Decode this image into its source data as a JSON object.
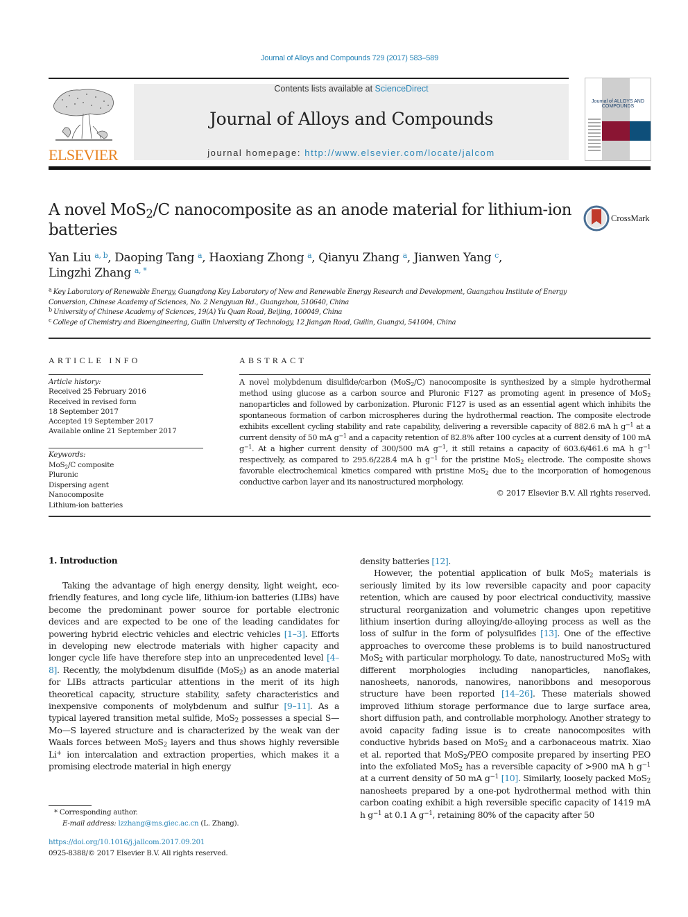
{
  "citation": "Journal of Alloys and Compounds 729 (2017) 583–589",
  "masthead": {
    "contents_prefix": "Contents lists available at ",
    "contents_link": "ScienceDirect",
    "journal_title": "Journal of Alloys and Compounds",
    "homepage_prefix": "journal homepage: ",
    "homepage_url": "http://www.elsevier.com/locate/jalcom",
    "publisher_logo": "ELSEVIER",
    "cover_text": "Journal of ALLOYS AND COMPOUNDS"
  },
  "colors": {
    "link": "#2a86b8",
    "elsevier_orange": "#e8821e",
    "masthead_bg": "#ededed",
    "cover_maroon": "#8a1533",
    "cover_blue": "#0e4f7a"
  },
  "article": {
    "title_part1": "A novel MoS",
    "title_sub": "2",
    "title_part2": "/C nanocomposite as an anode material for lithium-ion batteries",
    "crossmark_label": "CrossMark",
    "authors": [
      {
        "name": "Yan Liu",
        "aff": "a, b"
      },
      {
        "name": "Daoping Tang",
        "aff": "a"
      },
      {
        "name": "Haoxiang Zhong",
        "aff": "a"
      },
      {
        "name": "Qianyu Zhang",
        "aff": "a"
      },
      {
        "name": "Jianwen Yang",
        "aff": "c"
      },
      {
        "name": "Lingzhi Zhang",
        "aff": "a, *"
      }
    ],
    "affiliations": [
      {
        "key": "a",
        "text": "Key Laboratory of Renewable Energy, Guangdong Key Laboratory of New and Renewable Energy Research and Development, Guangzhou Institute of Energy Conversion, Chinese Academy of Sciences, No. 2 Nengyuan Rd., Guangzhou, 510640, China"
      },
      {
        "key": "b",
        "text": "University of Chinese Academy of Sciences, 19(A) Yu Quan Road, Beijing, 100049, China"
      },
      {
        "key": "c",
        "text": "College of Chemistry and Bioengineering, Guilin University of Technology, 12 Jiangan Road, Guilin, Guangxi, 541004, China"
      }
    ]
  },
  "article_info": {
    "heading": "ARTICLE INFO",
    "history_label": "Article history:",
    "history": [
      "Received 25 February 2016",
      "Received in revised form",
      "18 September 2017",
      "Accepted 19 September 2017",
      "Available online 21 September 2017"
    ],
    "keywords_label": "Keywords:",
    "keywords": [
      "MoS2/C composite",
      "Pluronic",
      "Dispersing agent",
      "Nanocomposite",
      "Lithium-ion batteries"
    ]
  },
  "abstract": {
    "heading": "ABSTRACT",
    "text": "A novel molybdenum disulfide/carbon (MoS₂/C) nanocomposite is synthesized by a simple hydrothermal method using glucose as a carbon source and Pluronic F127 as promoting agent in presence of MoS₂ nanoparticles and followed by carbonization. Pluronic F127 is used as an essential agent which inhibits the spontaneous formation of carbon microspheres during the hydrothermal reaction. The composite electrode exhibits excellent cycling stability and rate capability, delivering a reversible capacity of 882.6 mA h g⁻¹ at a current density of 50 mA g⁻¹ and a capacity retention of 82.8% after 100 cycles at a current density of 100 mA g⁻¹. At a higher current density of 300/500 mA g⁻¹, it still retains a capacity of 603.6/461.6 mA h g⁻¹ respectively, as compared to 295.6/228.4 mA h g⁻¹ for the pristine MoS₂ electrode. The composite shows favorable electrochemical kinetics compared with pristine MoS₂ due to the incorporation of homogenous conductive carbon layer and its nanostructured morphology.",
    "copyright": "© 2017 Elsevier B.V. All rights reserved."
  },
  "intro": {
    "heading": "1.  Introduction",
    "left_paragraph": "Taking the advantage of high energy density, light weight, eco-friendly features, and long cycle life, lithium-ion batteries (LIBs) have become the predominant power source for portable electronic devices and are expected to be one of the leading candidates for powering hybrid electric vehicles and electric vehicles [1–3]. Efforts in developing new electrode materials with higher capacity and longer cycle life have therefore step into an unprecedented level [4–8]. Recently, the molybdenum disulfide (MoS₂) as an anode material for LIBs attracts particular attentions in the merit of its high theoretical capacity, structure stability, safety characteristics and inexpensive components of molybdenum and sulfur [9–11]. As a typical layered transition metal sulfide, MoS₂ possesses a special S—Mo—S layered structure and is characterized by the weak van der Waals forces between MoS₂ layers and thus shows highly reversible Li⁺ ion intercalation and extraction properties, which makes it a promising electrode material in high energy",
    "right_continuation": "density batteries [12].",
    "right_paragraph": "However, the potential application of bulk MoS₂ materials is seriously limited by its low reversible capacity and poor capacity retention, which are caused by poor electrical conductivity, massive structural reorganization and volumetric changes upon repetitive lithium insertion during alloying/de-alloying process as well as the loss of sulfur in the form of polysulfides [13]. One of the effective approaches to overcome these problems is to build nanostructured MoS₂ with particular morphology. To date, nanostructured MoS₂ with different morphologies including nanoparticles, nanoflakes, nanosheets, nanorods, nanowires, nanoribbons and mesoporous structure have been reported [14–26]. These materials showed improved lithium storage performance due to large surface area, short diffusion path, and controllable morphology. Another strategy to avoid capacity fading issue is to create nanocomposites with conductive hybrids based on MoS₂ and a carbonaceous matrix. Xiao et al. reported that MoS₂/PEO composite prepared by inserting PEO into the exfoliated MoS₂ has a reversible capacity of >900 mA h g⁻¹ at a current density of 50 mA g⁻¹ [10]. Similarly, loosely packed MoS₂ nanosheets prepared by a one-pot hydrothermal method with thin carbon coating exhibit a high reversible specific capacity of 1419 mA h g⁻¹ at 0.1 A g⁻¹, retaining 80% of the capacity after 50",
    "citations": [
      "[1–3]",
      "[4–8]",
      "[9–11]",
      "[12]",
      "[13]",
      "[14–26]",
      "[10]"
    ]
  },
  "footnote": {
    "corresponding": "* Corresponding author.",
    "email_label": "E-mail address: ",
    "email": "lzzhang@ms.giec.ac.cn",
    "email_suffix": " (L. Zhang).",
    "doi": "https://doi.org/10.1016/j.jallcom.2017.09.201",
    "issn": "0925-8388/© 2017 Elsevier B.V. All rights reserved."
  }
}
